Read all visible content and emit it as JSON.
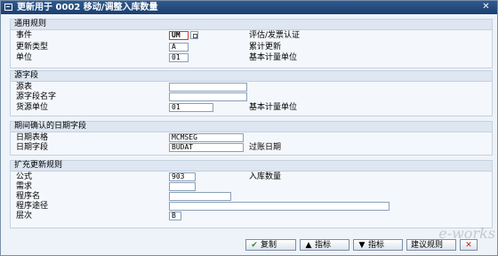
{
  "window": {
    "title": "更新用于 0002 移动/调整入库数量"
  },
  "groups": {
    "general": {
      "header": "通用规则",
      "event_label": "事件",
      "event_value": "UM",
      "event_desc": "评估/发票认证",
      "update_type_label": "更新类型",
      "update_type_value": "A",
      "update_type_desc": "累计更新",
      "unit_label": "单位",
      "unit_value": "01",
      "unit_desc": "基本计量单位"
    },
    "source": {
      "header": "源字段",
      "table_label": "源表",
      "table_value": "",
      "field_label": "源字段名字",
      "field_value": "",
      "cur_unit_label": "货源单位",
      "cur_unit_value": "01",
      "cur_unit_desc": "基本计量单位"
    },
    "period": {
      "header": "期间确认的日期字段",
      "date_table_label": "日期表格",
      "date_table_value": "MCMSEG",
      "date_field_label": "日期字段",
      "date_field_value": "BUDAT",
      "date_field_desc": "过账日期"
    },
    "ext": {
      "header": "扩充更新规则",
      "formula_label": "公式",
      "formula_value": "903",
      "formula_desc": "入库数量",
      "req_label": "需求",
      "req_value": "",
      "prog_label": "程序名",
      "prog_value": "",
      "path_label": "程序途径",
      "path_value": "",
      "level_label": "层次",
      "level_value": "B"
    }
  },
  "toolbar": {
    "copy_label": "复制",
    "up_label": "指标",
    "down_label": "指标",
    "propose_label": "建议规则"
  },
  "watermark": "e-works"
}
